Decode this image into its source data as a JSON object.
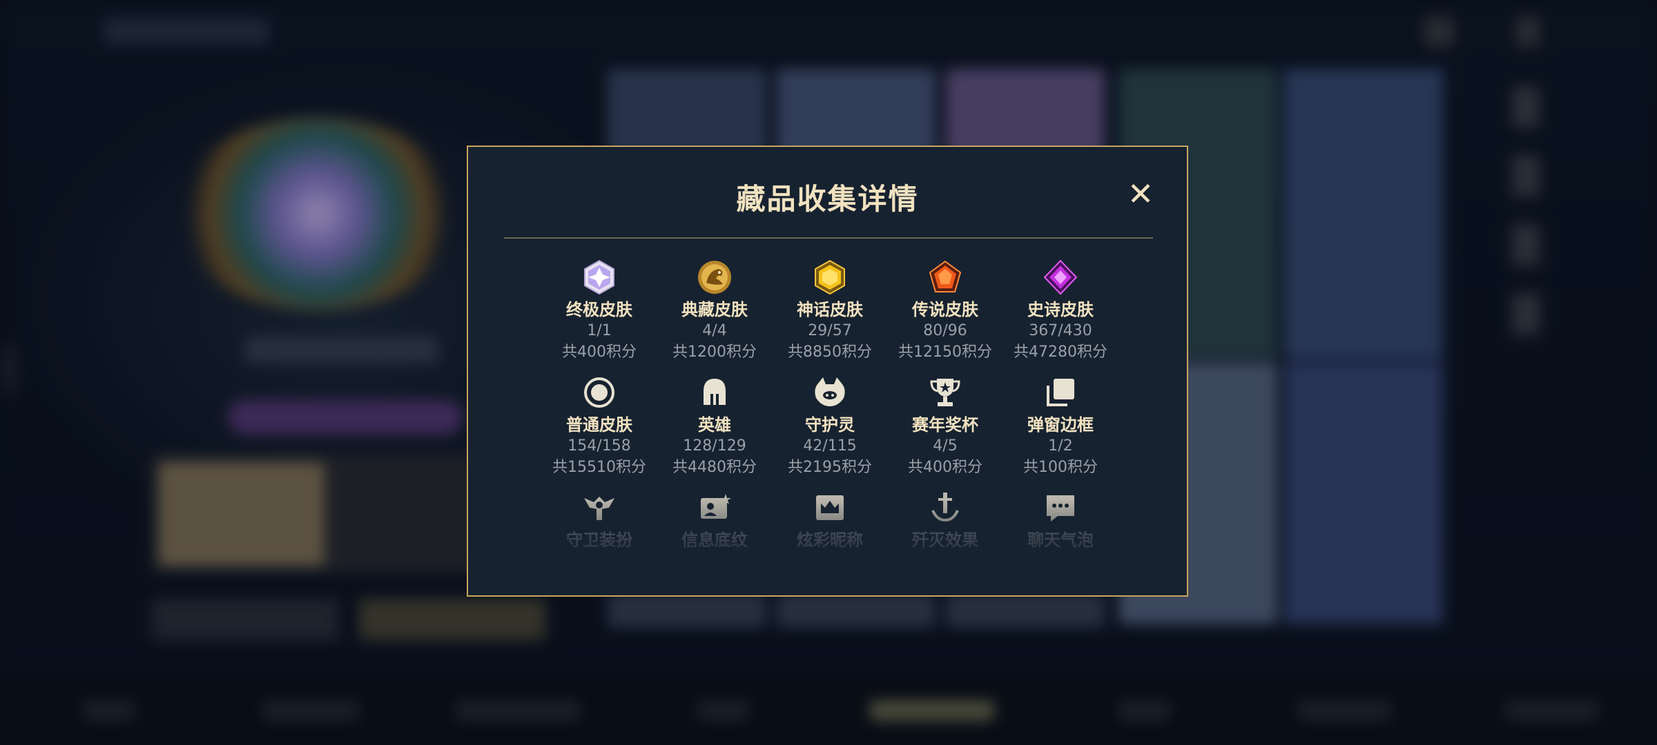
{
  "modal": {
    "title": "藏品收集详情",
    "close_icon": "close-icon",
    "rows": [
      [
        {
          "icon": "ultimate-skin-icon",
          "name": "终极皮肤",
          "count": "1/1",
          "points": "共400积分"
        },
        {
          "icon": "collector-skin-icon",
          "name": "典藏皮肤",
          "count": "4/4",
          "points": "共1200积分"
        },
        {
          "icon": "mythic-skin-icon",
          "name": "神话皮肤",
          "count": "29/57",
          "points": "共8850积分"
        },
        {
          "icon": "legendary-skin-icon",
          "name": "传说皮肤",
          "count": "80/96",
          "points": "共12150积分"
        },
        {
          "icon": "epic-skin-icon",
          "name": "史诗皮肤",
          "count": "367/430",
          "points": "共47280积分"
        }
      ],
      [
        {
          "icon": "normal-skin-icon",
          "name": "普通皮肤",
          "count": "154/158",
          "points": "共15510积分"
        },
        {
          "icon": "hero-helmet-icon",
          "name": "英雄",
          "count": "128/129",
          "points": "共4480积分"
        },
        {
          "icon": "spirit-pet-icon",
          "name": "守护灵",
          "count": "42/115",
          "points": "共2195积分"
        },
        {
          "icon": "trophy-icon",
          "name": "赛年奖杯",
          "count": "4/5",
          "points": "共400积分"
        },
        {
          "icon": "popup-frame-icon",
          "name": "弹窗边框",
          "count": "1/2",
          "points": "共100积分"
        }
      ],
      [
        {
          "icon": "guard-outfit-icon",
          "name": "守卫装扮"
        },
        {
          "icon": "profile-card-icon",
          "name": "信息底纹"
        },
        {
          "icon": "nickname-crown-icon",
          "name": "炫彩昵称"
        },
        {
          "icon": "elimination-effect-icon",
          "name": "歼灭效果"
        },
        {
          "icon": "chat-bubble-icon",
          "name": "聊天气泡"
        }
      ]
    ]
  },
  "colors": {
    "accent_gold": "#c9a65d",
    "title_text": "#f1e2c0",
    "muted_text": "#9aa0a8",
    "modal_bg": "#172230"
  }
}
